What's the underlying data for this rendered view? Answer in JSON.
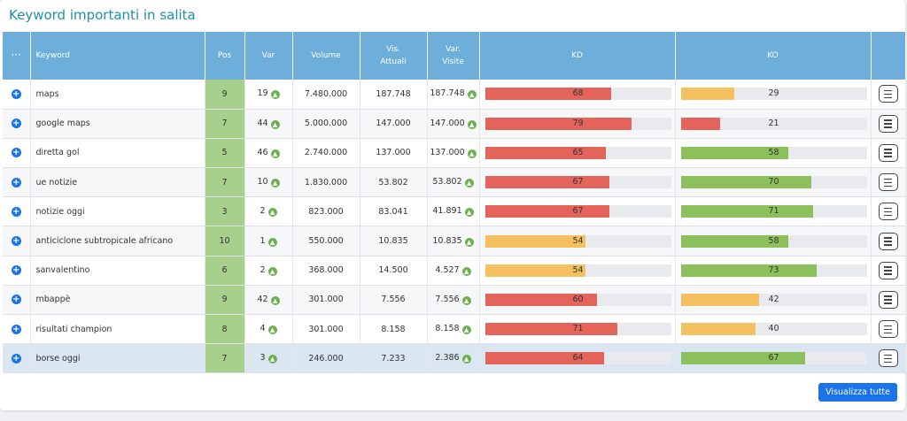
{
  "title": "Keyword importanti in salita",
  "headers": {
    "menu": "···",
    "keyword": "Keyword",
    "pos": "Pos",
    "var": "Var",
    "volume": "Volume",
    "vis_attuali_1": "Vis.",
    "vis_attuali_2": "Attuali",
    "var_visite_1": "Var.",
    "var_visite_2": "Visite",
    "kd": "KD",
    "ko": "KO"
  },
  "colors": {
    "red": "#e4635a",
    "yellow": "#f5c160",
    "green": "#8bc05a"
  },
  "rows": [
    {
      "keyword": "maps",
      "pos": "9",
      "var": "19",
      "volume": "7.480.000",
      "vis_attuali": "187.748",
      "var_visite": "187.748",
      "kd": 68,
      "kd_color": "#e4635a",
      "ko": 29,
      "ko_color": "#f5c160"
    },
    {
      "keyword": "google maps",
      "pos": "7",
      "var": "44",
      "volume": "5.000.000",
      "vis_attuali": "147.000",
      "var_visite": "147.000",
      "kd": 79,
      "kd_color": "#e4635a",
      "ko": 21,
      "ko_color": "#e4635a"
    },
    {
      "keyword": "diretta gol",
      "pos": "5",
      "var": "46",
      "volume": "2.740.000",
      "vis_attuali": "137.000",
      "var_visite": "137.000",
      "kd": 65,
      "kd_color": "#e4635a",
      "ko": 58,
      "ko_color": "#8bc05a"
    },
    {
      "keyword": "ue notizie",
      "pos": "7",
      "var": "10",
      "volume": "1.830.000",
      "vis_attuali": "53.802",
      "var_visite": "53.802",
      "kd": 67,
      "kd_color": "#e4635a",
      "ko": 70,
      "ko_color": "#8bc05a"
    },
    {
      "keyword": "notizie oggi",
      "pos": "3",
      "var": "2",
      "volume": "823.000",
      "vis_attuali": "83.041",
      "var_visite": "41.891",
      "kd": 67,
      "kd_color": "#e4635a",
      "ko": 71,
      "ko_color": "#8bc05a"
    },
    {
      "keyword": "anticiclone subtropicale africano",
      "pos": "10",
      "var": "1",
      "volume": "550.000",
      "vis_attuali": "10.835",
      "var_visite": "10.835",
      "kd": 54,
      "kd_color": "#f5c160",
      "ko": 58,
      "ko_color": "#8bc05a"
    },
    {
      "keyword": "sanvalentino",
      "pos": "6",
      "var": "2",
      "volume": "368.000",
      "vis_attuali": "14.500",
      "var_visite": "4.527",
      "kd": 54,
      "kd_color": "#f5c160",
      "ko": 73,
      "ko_color": "#8bc05a"
    },
    {
      "keyword": "mbappè",
      "pos": "9",
      "var": "42",
      "volume": "301.000",
      "vis_attuali": "7.556",
      "var_visite": "7.556",
      "kd": 60,
      "kd_color": "#e4635a",
      "ko": 42,
      "ko_color": "#f5c160"
    },
    {
      "keyword": "risultati champion",
      "pos": "8",
      "var": "4",
      "volume": "301.000",
      "vis_attuali": "8.158",
      "var_visite": "8.158",
      "kd": 71,
      "kd_color": "#e4635a",
      "ko": 40,
      "ko_color": "#f5c160"
    },
    {
      "keyword": "borse oggi",
      "pos": "7",
      "var": "3",
      "volume": "246.000",
      "vis_attuali": "7.233",
      "var_visite": "2.386",
      "kd": 64,
      "kd_color": "#e4635a",
      "ko": 67,
      "ko_color": "#8bc05a"
    }
  ],
  "footer_button": "Visualizza tutte"
}
